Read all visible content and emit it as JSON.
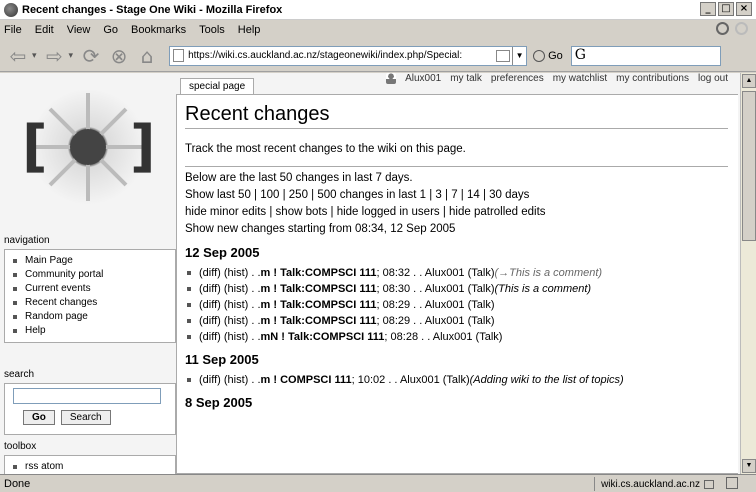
{
  "window": {
    "title": "Recent changes - Stage One Wiki - Mozilla Firefox",
    "buttons": [
      "_",
      "□",
      "×"
    ]
  },
  "menu": [
    "File",
    "Edit",
    "View",
    "Go",
    "Bookmarks",
    "Tools",
    "Help"
  ],
  "toolbar": {
    "url": "https://wiki.cs.auckland.ac.nz/stageonewiki/index.php/Special:",
    "go_label": "Go",
    "search_value": "G"
  },
  "user_links": [
    "Alux001",
    "my talk",
    "preferences",
    "my watchlist",
    "my contributions",
    "log out"
  ],
  "tab": "special page",
  "sidebar": {
    "navigation_heading": "navigation",
    "navigation": [
      "Main Page",
      "Community portal",
      "Current events",
      "Recent changes",
      "Random page",
      "Help"
    ],
    "search_heading": "search",
    "go_button": "Go",
    "search_button": "Search",
    "toolbox_heading": "toolbox",
    "toolbox": [
      "rss atom"
    ]
  },
  "content": {
    "title": "Recent changes",
    "intro": "Track the most recent changes to the wiki on this page.",
    "line1": "Below are the last 50 changes in last 7 days.",
    "line2": "Show last 50 | 100 | 250 | 500 changes in last 1 | 3 | 7 | 14 | 30 days",
    "line3": "hide minor edits | show bots | hide logged in users | hide patrolled edits",
    "line4": "Show new changes starting from 08:34, 12 Sep 2005",
    "days": [
      {
        "date": "12 Sep 2005",
        "entries": [
          {
            "pre": "(diff) (hist) . . ",
            "flag": "m ! Talk:COMPSCI 111",
            "time": "; 08:32 . . Alux001 (Talk) ",
            "comment": "(→This is a comment)",
            "grey": true
          },
          {
            "pre": "(diff) (hist) . . ",
            "flag": "m ! Talk:COMPSCI 111",
            "time": "; 08:30 . . Alux001 (Talk) ",
            "comment": "(This is a comment)",
            "grey": false
          },
          {
            "pre": "(diff) (hist) . . ",
            "flag": "m ! Talk:COMPSCI 111",
            "time": "; 08:29 . . Alux001 (Talk)",
            "comment": "",
            "grey": false
          },
          {
            "pre": "(diff) (hist) . . ",
            "flag": "m ! Talk:COMPSCI 111",
            "time": "; 08:29 . . Alux001 (Talk)",
            "comment": "",
            "grey": false
          },
          {
            "pre": "(diff) (hist) . . ",
            "flag": "mN ! Talk:COMPSCI 111",
            "time": "; 08:28 . . Alux001 (Talk)",
            "comment": "",
            "grey": false
          }
        ]
      },
      {
        "date": "11 Sep 2005",
        "entries": [
          {
            "pre": "(diff) (hist) . . ",
            "flag": "m ! COMPSCI 111",
            "time": "; 10:02 . . Alux001 (Talk) ",
            "comment": "(Adding wiki to the list of topics)",
            "grey": false
          }
        ]
      },
      {
        "date": "8 Sep 2005",
        "entries": []
      }
    ]
  },
  "status": {
    "text": "Done",
    "host": "wiki.cs.auckland.ac.nz"
  }
}
